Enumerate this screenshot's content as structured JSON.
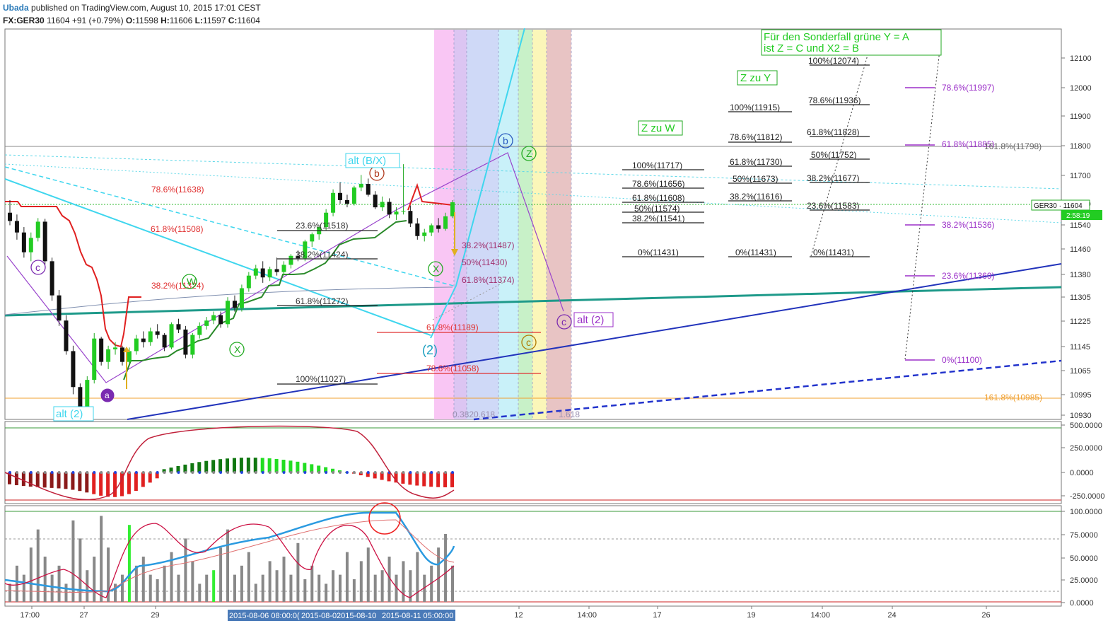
{
  "header": {
    "author": "Ubada",
    "published": "published on TradingView.com, August 10, 2015 17:01 CEST",
    "symbol": "FX:GER30",
    "last": "11604",
    "change": "+91 (+0.79%)",
    "o_label": "O:",
    "o": "11598",
    "h_label": "H:",
    "h": "11606",
    "l_label": "L:",
    "l": "11597",
    "c_label": "C:",
    "c": "11604"
  },
  "chart_data": {
    "type": "candlestick",
    "symbol": "FX:GER30",
    "price_axis_ticks": [
      "12100",
      "12000",
      "11900",
      "11800",
      "11700",
      "11620",
      "11540",
      "11460",
      "11380",
      "11305",
      "11225",
      "11145",
      "11065",
      "10995",
      "10930"
    ],
    "price_badge": "GER30 · 11604",
    "time_badge": "2:58:19",
    "ohlc": [
      [
        11575,
        11610,
        11540,
        11552
      ],
      [
        11552,
        11570,
        11500,
        11520
      ],
      [
        11520,
        11535,
        11450,
        11465
      ],
      [
        11465,
        11520,
        11440,
        11505
      ],
      [
        11505,
        11560,
        11495,
        11550
      ],
      [
        11550,
        11558,
        11430,
        11440
      ],
      [
        11440,
        11450,
        11330,
        11345
      ],
      [
        11345,
        11360,
        11260,
        11275
      ],
      [
        11275,
        11290,
        11180,
        11190
      ],
      [
        11190,
        11205,
        11070,
        11090
      ],
      [
        11090,
        11100,
        11010,
        11025
      ],
      [
        11025,
        11120,
        11015,
        11110
      ],
      [
        11110,
        11240,
        11100,
        11225
      ],
      [
        11225,
        11230,
        11150,
        11160
      ],
      [
        11160,
        11205,
        11140,
        11195
      ],
      [
        11195,
        11215,
        11180,
        11200
      ],
      [
        11200,
        11205,
        11150,
        11160
      ],
      [
        11160,
        11200,
        11150,
        11190
      ],
      [
        11190,
        11235,
        11180,
        11225
      ],
      [
        11225,
        11245,
        11200,
        11215
      ],
      [
        11215,
        11255,
        11205,
        11245
      ],
      [
        11245,
        11265,
        11225,
        11235
      ],
      [
        11235,
        11240,
        11190,
        11200
      ],
      [
        11200,
        11270,
        11195,
        11265
      ],
      [
        11265,
        11280,
        11240,
        11250
      ],
      [
        11250,
        11260,
        11170,
        11180
      ],
      [
        11180,
        11240,
        11170,
        11235
      ],
      [
        11235,
        11270,
        11225,
        11260
      ],
      [
        11260,
        11285,
        11250,
        11275
      ],
      [
        11275,
        11300,
        11265,
        11290
      ],
      [
        11290,
        11300,
        11255,
        11265
      ],
      [
        11265,
        11340,
        11255,
        11330
      ],
      [
        11330,
        11345,
        11300,
        11310
      ],
      [
        11310,
        11375,
        11300,
        11365
      ],
      [
        11365,
        11410,
        11355,
        11400
      ],
      [
        11400,
        11430,
        11390,
        11420
      ],
      [
        11420,
        11440,
        11380,
        11395
      ],
      [
        11395,
        11425,
        11385,
        11418
      ],
      [
        11418,
        11450,
        11400,
        11410
      ],
      [
        11410,
        11440,
        11400,
        11430
      ],
      [
        11430,
        11460,
        11420,
        11455
      ],
      [
        11455,
        11470,
        11440,
        11448
      ],
      [
        11448,
        11500,
        11440,
        11495
      ],
      [
        11495,
        11520,
        11480,
        11515
      ],
      [
        11515,
        11540,
        11500,
        11535
      ],
      [
        11535,
        11585,
        11525,
        11575
      ],
      [
        11575,
        11640,
        11565,
        11630
      ],
      [
        11630,
        11660,
        11600,
        11610
      ],
      [
        11610,
        11625,
        11590,
        11600
      ],
      [
        11600,
        11650,
        11595,
        11645
      ],
      [
        11645,
        11680,
        11635,
        11655
      ],
      [
        11655,
        11670,
        11620,
        11625
      ],
      [
        11625,
        11635,
        11585,
        11590
      ],
      [
        11590,
        11620,
        11580,
        11605
      ],
      [
        11605,
        11615,
        11560,
        11570
      ],
      [
        11570,
        11590,
        11555,
        11578
      ],
      [
        11578,
        11710,
        11570,
        11580
      ],
      [
        11580,
        11595,
        11535,
        11545
      ],
      [
        11545,
        11560,
        11500,
        11510
      ],
      [
        11510,
        11530,
        11495,
        11520
      ],
      [
        11520,
        11545,
        11510,
        11540
      ],
      [
        11540,
        11560,
        11520,
        11530
      ],
      [
        11530,
        11575,
        11525,
        11565
      ],
      [
        11565,
        11610,
        11560,
        11604
      ]
    ],
    "fib_labels": [
      {
        "text": "78.6%(11638)",
        "color": "#e03030"
      },
      {
        "text": "61.8%(11508)",
        "color": "#e03030"
      },
      {
        "text": "38.2%(11324)",
        "color": "#e03030"
      },
      {
        "text": "23.6%(11518)",
        "color": "#333333"
      },
      {
        "text": "38.2%(11424)",
        "color": "#333333"
      },
      {
        "text": "61.8%(11272)",
        "color": "#333333"
      },
      {
        "text": "100%(11027)",
        "color": "#333333"
      },
      {
        "text": "38.2%(11487)",
        "color": "#a0306e"
      },
      {
        "text": "50%(11430)",
        "color": "#a0306e"
      },
      {
        "text": "61.8%(11374)",
        "color": "#a0306e"
      },
      {
        "text": "61.8%(11189)",
        "color": "#e03030"
      },
      {
        "text": "78.6%(11058)",
        "color": "#e03030"
      },
      {
        "text": "100%(11717)",
        "color": "#222222"
      },
      {
        "text": "78.6%(11656)",
        "color": "#222222"
      },
      {
        "text": "61.8%(11608)",
        "color": "#222222"
      },
      {
        "text": "50%(11574)",
        "color": "#222222"
      },
      {
        "text": "38.2%(11541)",
        "color": "#222222"
      },
      {
        "text": "0%(11431)",
        "color": "#222222"
      },
      {
        "text": "100%(11915)",
        "color": "#222222"
      },
      {
        "text": "78.6%(11812)",
        "color": "#222222"
      },
      {
        "text": "61.8%(11730)",
        "color": "#222222"
      },
      {
        "text": "50%(11673)",
        "color": "#222222"
      },
      {
        "text": "38.2%(11616)",
        "color": "#222222"
      },
      {
        "text": "0%(11431)",
        "color": "#222222"
      },
      {
        "text": "100%(12074)",
        "color": "#222222"
      },
      {
        "text": "78.6%(11936)",
        "color": "#222222"
      },
      {
        "text": "61.8%(11828)",
        "color": "#222222"
      },
      {
        "text": "50%(11752)",
        "color": "#222222"
      },
      {
        "text": "38.2%(11677)",
        "color": "#222222"
      },
      {
        "text": "23.6%(11583)",
        "color": "#222222"
      },
      {
        "text": "0%(11431)",
        "color": "#222222"
      },
      {
        "text": "78.6%(11997)",
        "color": "#9b2fc8"
      },
      {
        "text": "61.8%(11885)",
        "color": "#9b2fc8"
      },
      {
        "text": "38.2%(11536)",
        "color": "#9b2fc8"
      },
      {
        "text": "23.6%(11369)",
        "color": "#9b2fc8"
      },
      {
        "text": "0%(11100)",
        "color": "#9b2fc8"
      },
      {
        "text": "161.8%(11798)",
        "color": "#666666"
      },
      {
        "text": "161.8%(10985)",
        "color": "#f0a030"
      },
      {
        "text": "0.382",
        "color": "#9a8fb0"
      },
      {
        "text": "0.618",
        "color": "#9a8fb0"
      },
      {
        "text": "1.618",
        "color": "#9a8fb0"
      }
    ],
    "wave_labels": [
      "c",
      "a",
      "W",
      "X",
      "b",
      "X",
      "(2)",
      "b",
      "Z",
      "c",
      "c",
      "alt (2)",
      "alt (2)",
      "alt (B/X)"
    ],
    "annotations": [
      "Für den Sonderfall grüne Y = A",
      "ist Z = C und X2 = B",
      "Z zu Y",
      "Z zu W"
    ],
    "macd_axis": [
      "500.0000",
      "250.0000",
      "0.0000",
      "-250.0000"
    ],
    "stoch_axis": [
      "100.0000",
      "75.0000",
      "50.0000",
      "25.0000",
      "0.0000"
    ],
    "time_ticks": [
      "17:00",
      "27",
      "29",
      "12",
      "14:00",
      "17",
      "19",
      "14:00",
      "24",
      "26"
    ],
    "time_badges": [
      "2015-08-06 08:00:0(",
      "2015-08-0",
      "2015-08-10",
      "2015-08-11 05:00:00"
    ]
  }
}
